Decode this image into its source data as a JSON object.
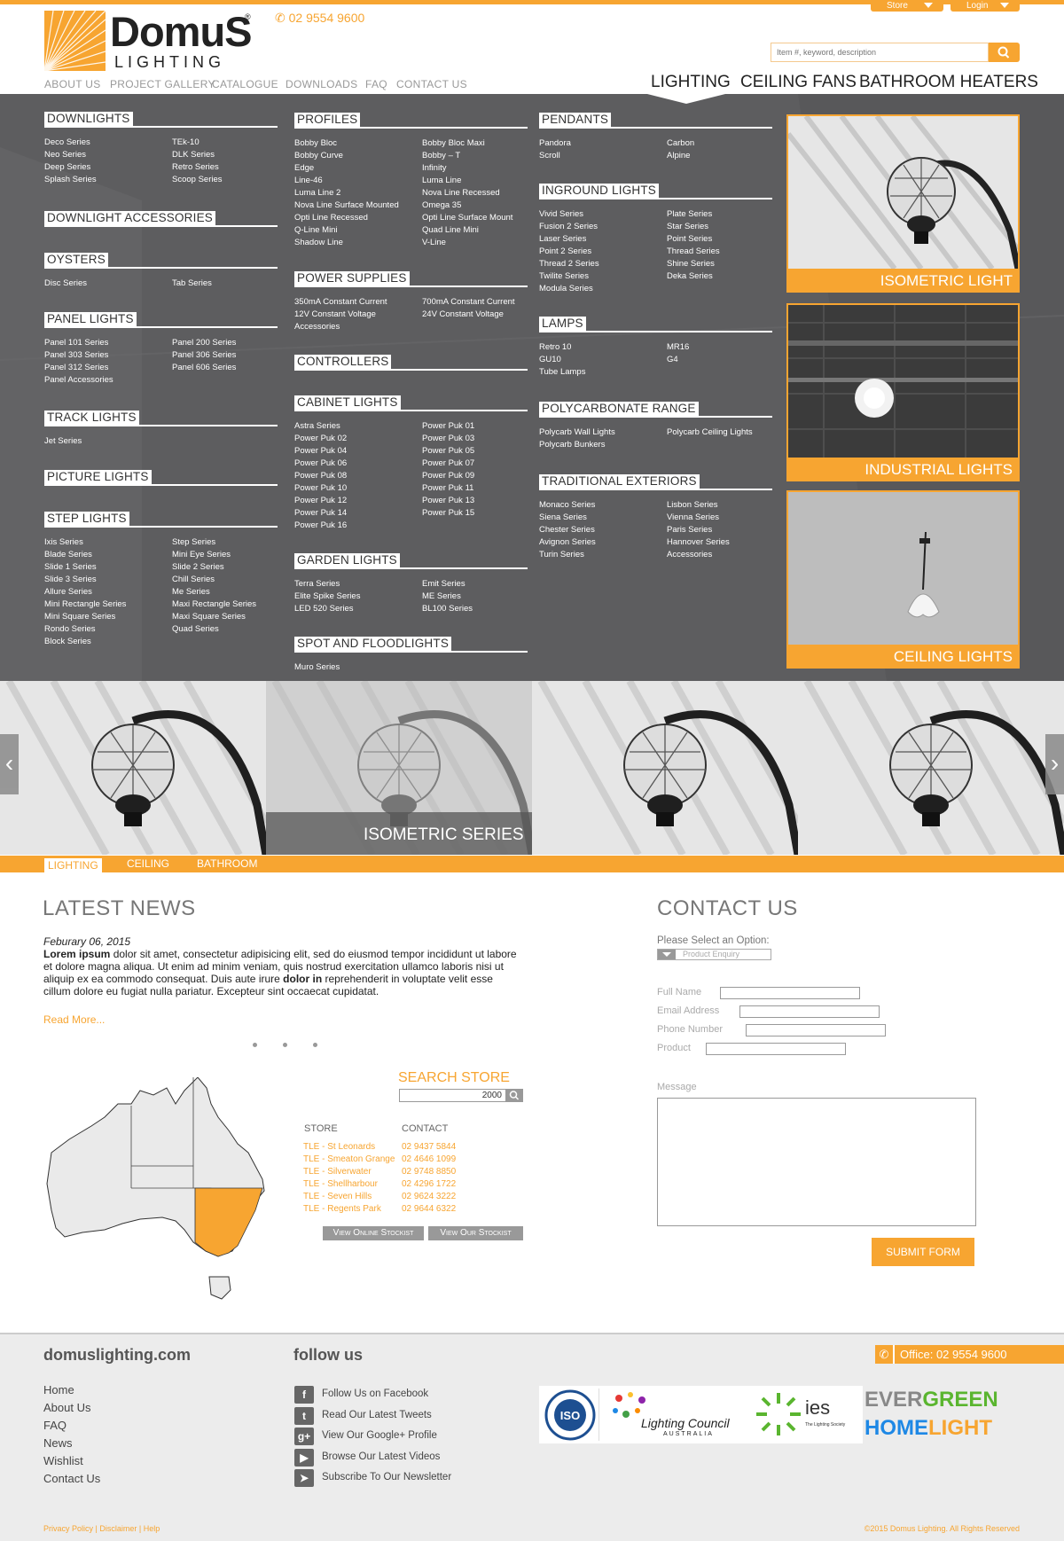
{
  "header": {
    "phone": "02 9554 9600",
    "store_label": "Store",
    "login_label": "Login",
    "logo_word": "DomuS",
    "logo_sub": "LIGHTING",
    "search_placeholder": "Item #, keyword, description",
    "top_nav": [
      "ABOUT US",
      "PROJECT GALLERY",
      "CATALOGUE",
      "DOWNLOADS",
      "FAQ",
      "CONTACT US"
    ],
    "main_nav": [
      "LIGHTING",
      "CEILING FANS",
      "BATHROOM HEATERS"
    ]
  },
  "menu": {
    "col1": [
      {
        "title": "DOWNLIGHTS",
        "items": [
          "Deco Series",
          "TEk-10",
          "Neo Series",
          "DLK Series",
          "Deep Series",
          "Retro Series",
          "Splash Series",
          "Scoop Series"
        ]
      },
      {
        "title": "DOWNLIGHT ACCESSORIES",
        "items": []
      },
      {
        "title": "OYSTERS",
        "items": [
          "Disc Series",
          "Tab Series"
        ]
      },
      {
        "title": "PANEL LIGHTS",
        "items": [
          "Panel 101 Series",
          "Panel 200 Series",
          "Panel 303 Series",
          "Panel 306 Series",
          "Panel 312 Series",
          "Panel 606 Series",
          "Panel Accessories"
        ]
      },
      {
        "title": "TRACK LIGHTS",
        "items": [
          "Jet Series"
        ]
      },
      {
        "title": "PICTURE LIGHTS",
        "items": []
      },
      {
        "title": "STEP LIGHTS",
        "items": [
          "Ixis Series",
          "Step Series",
          "Blade Series",
          "Mini Eye Series",
          "Slide 1 Series",
          "Slide 2 Series",
          "Slide 3 Series",
          "Chill Series",
          "Allure Series",
          "Me Series",
          "Mini Rectangle Series",
          "Maxi Rectangle Series",
          "Mini Square Series",
          "Maxi Square Series",
          "Rondo Series",
          "Quad Series",
          "Block Series"
        ]
      }
    ],
    "col2": [
      {
        "title": "PROFILES",
        "items": [
          "Bobby Bloc",
          "Bobby Bloc Maxi",
          "Bobby Curve",
          "Bobby – T",
          "Edge",
          "Infinity",
          "Line-46",
          "Luma Line",
          "Luma Line 2",
          "Nova Line Recessed",
          "Nova Line Surface Mounted",
          "Omega 35",
          "Opti Line Recessed",
          "Opti Line Surface Mount",
          "Q-Line Mini",
          "Quad Line Mini",
          "Shadow Line",
          "V-Line"
        ]
      },
      {
        "title": "POWER SUPPLIES",
        "items": [
          "350mA Constant Current",
          "700mA Constant Current",
          "12V Constant Voltage",
          "24V Constant Voltage",
          "Accessories"
        ]
      },
      {
        "title": "CONTROLLERS",
        "items": []
      },
      {
        "title": "CABINET LIGHTS",
        "items": [
          "Astra Series",
          "Power Puk 01",
          "Power Puk 02",
          "Power Puk 03",
          "Power Puk 04",
          "Power Puk 05",
          "Power Puk 06",
          "Power Puk 07",
          "Power Puk 08",
          "Power Puk 09",
          "Power Puk 10",
          "Power Puk 11",
          "Power Puk 12",
          "Power Puk 13",
          "Power Puk 14",
          "Power Puk 15",
          "Power Puk 16"
        ]
      },
      {
        "title": "GARDEN LIGHTS",
        "items": [
          "Terra Series",
          "Emit Series",
          "Elite Spike Series",
          "ME Series",
          "LED 520 Series",
          "BL100 Series"
        ]
      },
      {
        "title": "SPOT AND FLOODLIGHTS",
        "items": [
          "Muro Series"
        ]
      }
    ],
    "col3": [
      {
        "title": "PENDANTS",
        "items": [
          "Pandora",
          "Carbon",
          "Scroll",
          "Alpine"
        ]
      },
      {
        "title": "INGROUND LIGHTS",
        "items": [
          "Vivid Series",
          "Plate Series",
          "Fusion 2 Series",
          "Star Series",
          "Laser Series",
          "Point Series",
          "Point 2 Series",
          "Thread Series",
          "Thread 2 Series",
          "Shine Series",
          "Twilite Series",
          "Deka Series",
          "Modula Series"
        ]
      },
      {
        "title": "LAMPS",
        "items": [
          "Retro 10",
          "MR16",
          "GU10",
          "G4",
          "Tube Lamps"
        ]
      },
      {
        "title": "POLYCARBONATE RANGE",
        "items": [
          "Polycarb Wall Lights",
          "Polycarb Ceiling Lights",
          "Polycarb Bunkers"
        ]
      },
      {
        "title": "TRADITIONAL EXTERIORS",
        "items": [
          "Monaco Series",
          "Lisbon Series",
          "Siena Series",
          "Vienna Series",
          "Chester Series",
          "Paris Series",
          "Avignon Series",
          "Hannover Series",
          "Turin Series",
          "Accessories"
        ]
      }
    ],
    "promos": [
      "ISOMETRIC LIGHT",
      "INDUSTRIAL LIGHTS",
      "CEILING LIGHTS"
    ]
  },
  "slider": {
    "caption": "ISOMETRIC SERIES",
    "tabs": [
      "LIGHTING",
      "CEILING",
      "BATHROOM"
    ]
  },
  "news": {
    "heading": "LATEST NEWS",
    "date": "Feburary 06, 2015",
    "lead": "Lorem ipsum",
    "body1": " dolor sit amet, consectetur adipisicing elit, sed do eiusmod tempor incididunt ut labore et dolore magna aliqua. Ut enim ad minim veniam, quis nostrud exercitation ullamco laboris nisi ut aliquip ex ea commodo consequat. Duis aute irure ",
    "bold2": "dolor in",
    "body2": " reprehenderit in voluptate velit esse cillum dolore eu fugiat nulla pariatur. Excepteur sint occaecat cupidatat.",
    "read_more": "Read More..."
  },
  "store": {
    "heading": "SEARCH STORE",
    "query": "2000",
    "col_store": "STORE",
    "col_contact": "CONTACT",
    "rows": [
      {
        "store": "TLE - St Leonards",
        "contact": "02 9437 5844"
      },
      {
        "store": "TLE - Smeaton Grange",
        "contact": "02 4646 1099"
      },
      {
        "store": "TLE - Silverwater",
        "contact": "02 9748 8850"
      },
      {
        "store": "TLE - Shellharbour",
        "contact": "02 4296 1722"
      },
      {
        "store": "TLE - Seven Hills",
        "contact": "02 9624 3222"
      },
      {
        "store": "TLE - Regents Park",
        "contact": "02 9644 6322"
      }
    ],
    "btn_online": "View Online Stockist",
    "btn_our": "View Our Stockist"
  },
  "contact": {
    "heading": "CONTACT US",
    "select_label": "Please Select an Option:",
    "select_value": "Product Enquiry",
    "full_name": "Full Name",
    "email": "Email Address",
    "phone": "Phone Number",
    "product": "Product",
    "message": "Message",
    "submit": "SUBMIT FORM"
  },
  "footer": {
    "site": "domuslighting.com",
    "links": [
      "Home",
      "About Us",
      "FAQ",
      "News",
      "Wishlist",
      "Contact Us"
    ],
    "follow_heading": "follow us",
    "social": [
      {
        "icon": "facebook-icon",
        "glyph": "f",
        "label": "Follow Us on Facebook"
      },
      {
        "icon": "twitter-icon",
        "glyph": "t",
        "label": "Read Our Latest Tweets"
      },
      {
        "icon": "google-plus-icon",
        "glyph": "g+",
        "label": "View Our Google+ Profile"
      },
      {
        "icon": "youtube-icon",
        "glyph": "▶",
        "label": "Browse Our Latest Videos"
      },
      {
        "icon": "newsletter-icon",
        "glyph": "➤",
        "label": "Subscribe To Our Newsletter"
      }
    ],
    "office": "Office: 02 9554 9600",
    "logo_lc1": "Lighting Council",
    "logo_lc2": "AUSTRALIA",
    "logo_ies": "ies",
    "logo_ies_sub": "The Lighting Society",
    "logo_ever": "EVER",
    "logo_green": "GREEN",
    "logo_home": "HOME",
    "logo_light": "LIGHT",
    "legal": "Privacy Policy | Disclaimer | Help",
    "copyright": "©2015 Domus Lighting. All Rights Reserved"
  },
  "colors": {
    "accent": "#f7a531",
    "menu_bg": "#5d5d5f"
  }
}
